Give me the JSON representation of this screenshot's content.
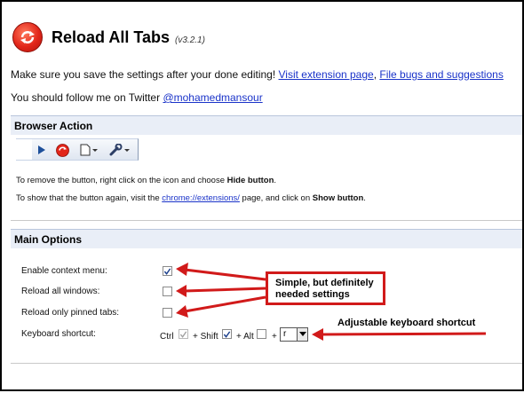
{
  "header": {
    "title": "Reload All Tabs",
    "version": "(v3.2.1)"
  },
  "intro": {
    "save_text": "Make sure you save the settings after your done editing!",
    "visit_link": "Visit extension page",
    "separator": ",",
    "bugs_link": "File bugs and suggestions",
    "follow_text": "You should follow me on Twitter",
    "twitter_link": "@mohamedmansour"
  },
  "browser_action": {
    "heading": "Browser Action",
    "toolbar_icons": [
      "play-icon",
      "reload-icon",
      "page-menu-icon",
      "wrench-menu-icon"
    ],
    "remove_prefix": "To remove the button, right click on the icon and choose",
    "remove_bold": "Hide button",
    "remove_suffix": ".",
    "show_prefix": "To show that the button again, visit the",
    "show_link": "chrome://extensions/",
    "show_middle": "page, and click on",
    "show_bold": "Show button",
    "show_suffix": "."
  },
  "main_options": {
    "heading": "Main Options",
    "options": [
      {
        "label": "Enable context menu:",
        "checked": true
      },
      {
        "label": "Reload all windows:",
        "checked": false
      },
      {
        "label": "Reload only pinned tabs:",
        "checked": false
      }
    ],
    "shortcut": {
      "label": "Keyboard shortcut:",
      "ctrl_label": "Ctrl",
      "ctrl_checked": true,
      "shift_label": "+ Shift",
      "shift_checked": true,
      "alt_label": "+ Alt",
      "alt_checked": false,
      "plus_label": "+",
      "key_value": "r"
    }
  },
  "annotations": {
    "callout_line1": "Simple, but definitely",
    "callout_line2": "needed settings",
    "shortcut_note": "Adjustable keyboard shortcut",
    "color": "#d11a1a"
  },
  "colors": {
    "section_bg": "#e9eef7",
    "link": "#1a33c9",
    "logo_red": "#e2261a"
  }
}
